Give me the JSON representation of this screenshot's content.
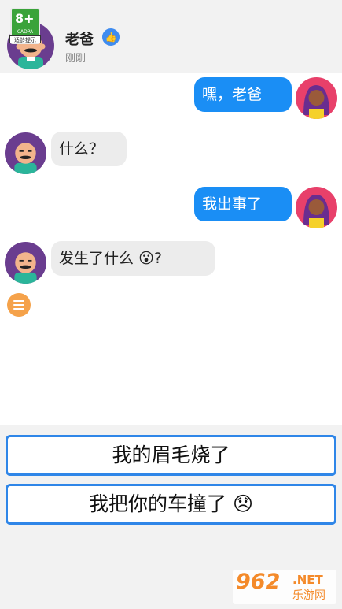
{
  "header": {
    "contact_name": "老爸",
    "status": "刚刚",
    "rating_badge": {
      "age": "8+",
      "org": "CADPA",
      "tip": "适龄提示"
    }
  },
  "messages": [
    {
      "from": "me",
      "text": "嘿，老爸"
    },
    {
      "from": "dad",
      "text": "什么？"
    },
    {
      "from": "me",
      "text": "我出事了"
    },
    {
      "from": "dad",
      "text": "发生了什么",
      "emoji": "😮",
      "suffix": "?"
    }
  ],
  "options": [
    {
      "text": "我的眉毛烧了"
    },
    {
      "text": "我把你的车撞了",
      "emoji": "😞"
    }
  ],
  "watermark": {
    "brand": "962",
    "domain": ".NET",
    "name": "乐游网"
  },
  "colors": {
    "accent": "#1a8ef5",
    "option_border": "#2f86e8",
    "menu": "#f5a24a"
  }
}
